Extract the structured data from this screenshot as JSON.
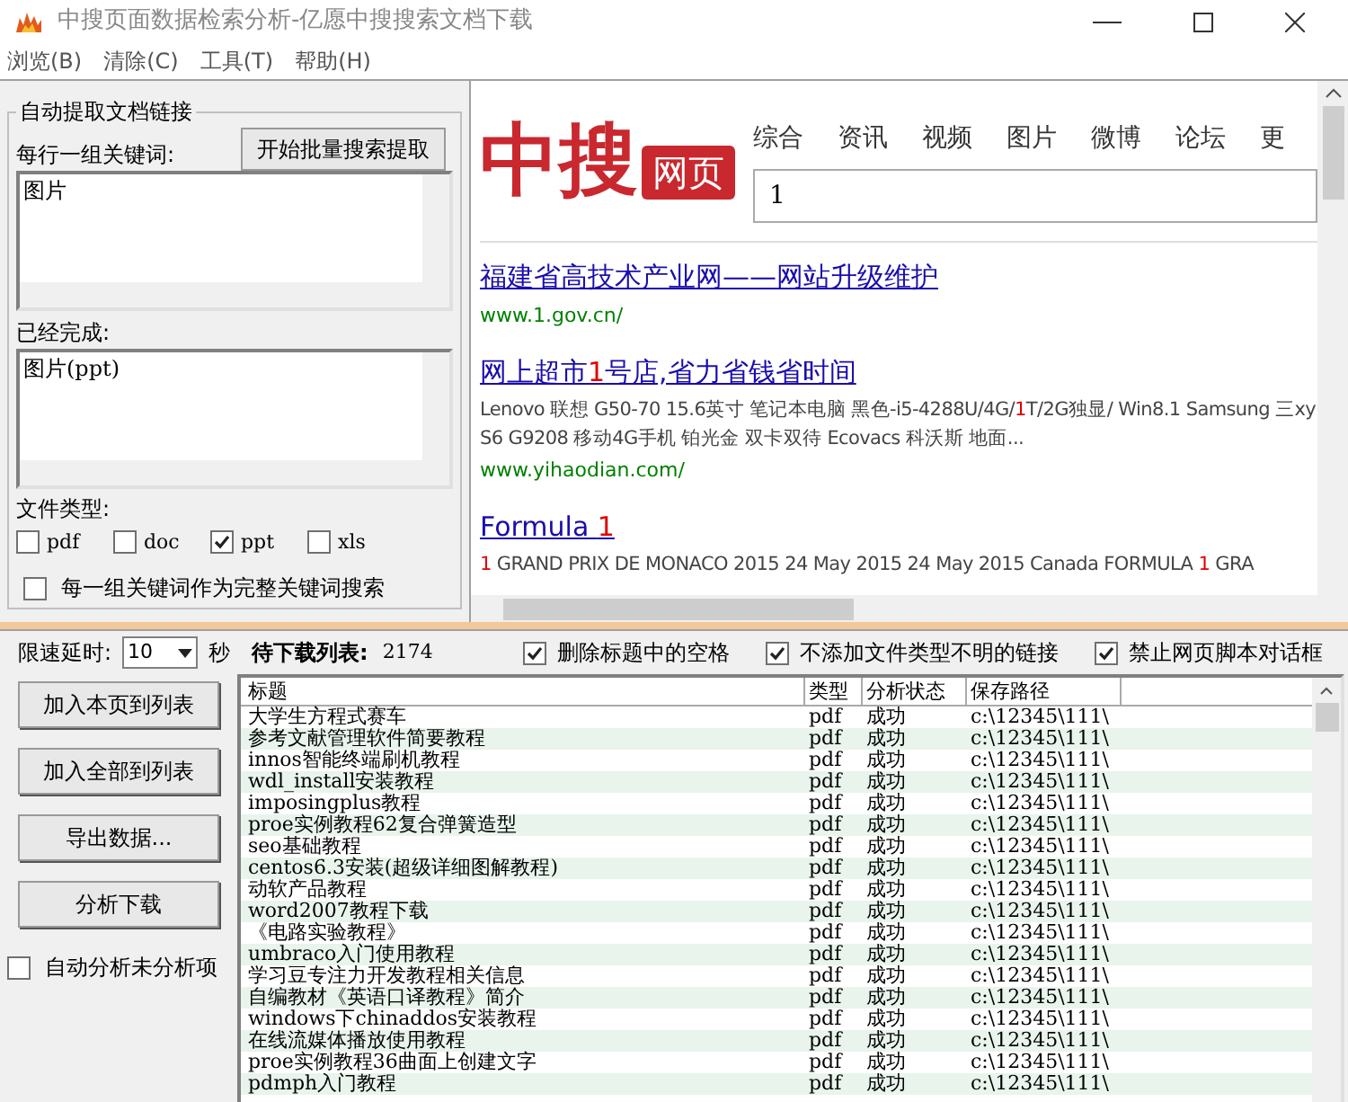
{
  "window": {
    "title": "中搜页面数据检索分析-亿愿中搜搜索文档下载"
  },
  "menu": [
    "浏览(B)",
    "清除(C)",
    "工具(T)",
    "帮助(H)"
  ],
  "extract_panel": {
    "title": "自动提取文档链接",
    "start_button": "开始批量搜索提取",
    "keywords_label": "每行一组关键词:",
    "keywords_value": "图片",
    "done_label": "已经完成:",
    "done_value": "图片(ppt)",
    "filetype_label": "文件类型:",
    "filetypes": [
      {
        "label": "pdf",
        "checked": false
      },
      {
        "label": "doc",
        "checked": false
      },
      {
        "label": "ppt",
        "checked": true
      },
      {
        "label": "xls",
        "checked": false
      }
    ],
    "whole_keyword": {
      "label": "每一组关键词作为完整关键词搜索",
      "checked": false
    }
  },
  "browser": {
    "logo_text": "中搜",
    "logo_badge": "网页",
    "nav": [
      "综合",
      "资讯",
      "视频",
      "图片",
      "微博",
      "论坛",
      "更"
    ],
    "search_value": "1",
    "results": [
      {
        "title_parts": [
          {
            "text": "福建省高技术产业网——网站升级维护",
            "highlight": false
          }
        ],
        "url": "www.1.gov.cn/"
      },
      {
        "title_parts": [
          {
            "text": "网上超市",
            "highlight": false
          },
          {
            "text": "1",
            "highlight": true
          },
          {
            "text": "号店,省力省钱省时间",
            "highlight": false
          }
        ],
        "snippet_parts": [
          {
            "text": "Lenovo 联想 G50-70 15.6英寸 笔记本电脑 黑色-i5-4288U/4G/",
            "highlight": false
          },
          {
            "text": "1",
            "highlight": true
          },
          {
            "text": "T/2G独显/ Win8.1 Samsung 三xy S6 G9208 移动4G手机 铂光金 双卡双待 Ecovacs 科沃斯 地面...",
            "highlight": false
          }
        ],
        "url": "www.yihaodian.com/"
      },
      {
        "title_parts": [
          {
            "text": "Formula ",
            "highlight": false
          },
          {
            "text": "1",
            "highlight": true
          }
        ],
        "snippet_parts": [
          {
            "text": "1",
            "highlight": true
          },
          {
            "text": " GRAND PRIX DE MONACO 2015 24 May 2015 24 May 2015 Canada FORMULA ",
            "highlight": false
          },
          {
            "text": "1",
            "highlight": true
          },
          {
            "text": " GRA",
            "highlight": false
          }
        ]
      }
    ]
  },
  "controls": {
    "delay_label": "限速延时:",
    "delay_value": "10",
    "delay_unit": "秒",
    "queue_label": "待下载列表:",
    "queue_count": "2174",
    "options": [
      {
        "label": "删除标题中的空格",
        "checked": true
      },
      {
        "label": "不添加文件类型不明的链接",
        "checked": true
      },
      {
        "label": "禁止网页脚本对话框",
        "checked": true
      }
    ]
  },
  "actions": [
    "加入本页到列表",
    "加入全部到列表",
    "导出数据...",
    "分析下载"
  ],
  "auto_analyze": {
    "label": "自动分析未分析项",
    "checked": false
  },
  "table": {
    "columns": [
      "标题",
      "类型",
      "分析状态",
      "保存路径"
    ],
    "rows": [
      [
        "大学生方程式赛车",
        "pdf",
        "成功",
        "c:\\12345\\111\\"
      ],
      [
        "参考文献管理软件简要教程",
        "pdf",
        "成功",
        "c:\\12345\\111\\"
      ],
      [
        "innos智能终端刷机教程",
        "pdf",
        "成功",
        "c:\\12345\\111\\"
      ],
      [
        "wdl_install安装教程",
        "pdf",
        "成功",
        "c:\\12345\\111\\"
      ],
      [
        "imposingplus教程",
        "pdf",
        "成功",
        "c:\\12345\\111\\"
      ],
      [
        "proe实例教程62复合弹簧造型",
        "pdf",
        "成功",
        "c:\\12345\\111\\"
      ],
      [
        "seo基础教程",
        "pdf",
        "成功",
        "c:\\12345\\111\\"
      ],
      [
        "centos6.3安装(超级详细图解教程)",
        "pdf",
        "成功",
        "c:\\12345\\111\\"
      ],
      [
        "动软产品教程",
        "pdf",
        "成功",
        "c:\\12345\\111\\"
      ],
      [
        "word2007教程下载",
        "pdf",
        "成功",
        "c:\\12345\\111\\"
      ],
      [
        "《电路实验教程》",
        "pdf",
        "成功",
        "c:\\12345\\111\\"
      ],
      [
        "umbraco入门使用教程",
        "pdf",
        "成功",
        "c:\\12345\\111\\"
      ],
      [
        "学习豆专注力开发教程相关信息",
        "pdf",
        "成功",
        "c:\\12345\\111\\"
      ],
      [
        "自编教材《英语口译教程》简介",
        "pdf",
        "成功",
        "c:\\12345\\111\\"
      ],
      [
        "windows下chinaddos安装教程",
        "pdf",
        "成功",
        "c:\\12345\\111\\"
      ],
      [
        "在线流媒体播放使用教程",
        "pdf",
        "成功",
        "c:\\12345\\111\\"
      ],
      [
        "proe实例教程36曲面上创建文字",
        "pdf",
        "成功",
        "c:\\12345\\111\\"
      ],
      [
        "pdmph入门教程",
        "pdf",
        "成功",
        "c:\\12345\\111\\"
      ]
    ]
  }
}
